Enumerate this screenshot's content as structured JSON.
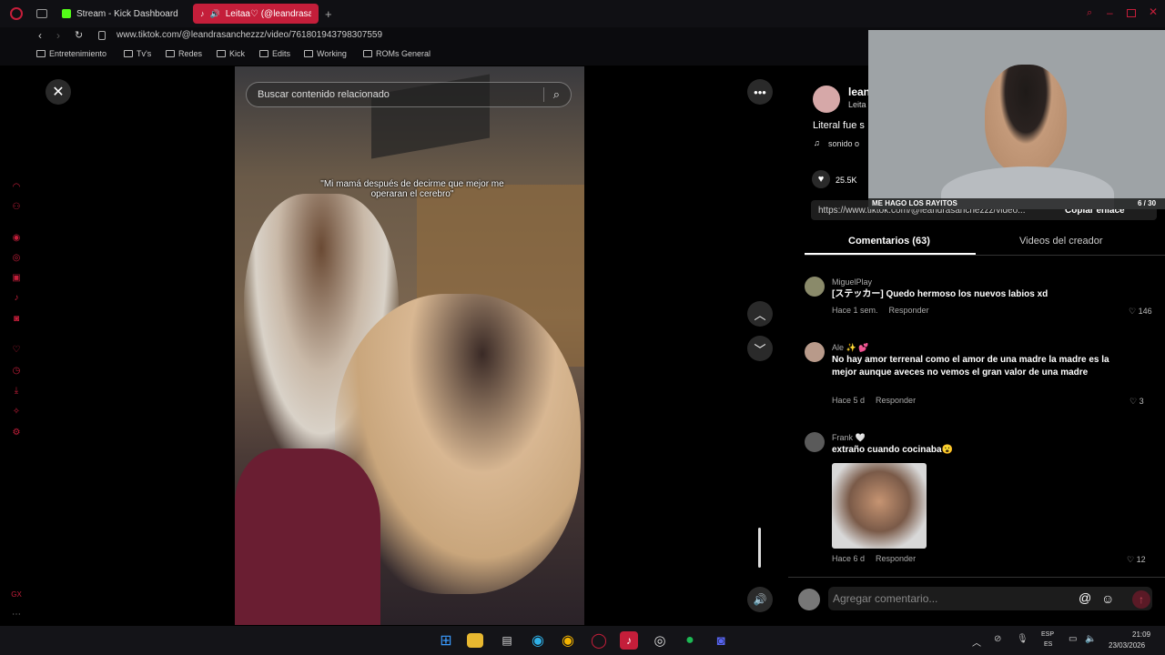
{
  "tabs": [
    {
      "label": "Stream - Kick Dashboard",
      "icon": "kick-icon"
    },
    {
      "label": "Leitaa♡ (@leandrasan",
      "icon": "tiktok-icon"
    }
  ],
  "address": {
    "url": "www.tiktok.com/@leandrasanchezzz/video/761801943798307559"
  },
  "bookmarks": [
    "Entretenimiento",
    "Tv's",
    "Redes",
    "Kick",
    "Edits",
    "Working",
    "ROMs General"
  ],
  "video": {
    "search_placeholder": "Buscar contenido relacionado",
    "caption": "\"Mi mamá después de decirme que mejor me operaran el cerebro\""
  },
  "creator": {
    "name": "lean",
    "nickname": "Leita",
    "description": "Literal fue s",
    "sound": "sonido o",
    "likes": "25.5K",
    "link": "https://www.tiktok.com/@leandrasanchezzz/video...",
    "copy_link_label": "Copiar enlace"
  },
  "panel_tabs": {
    "comments": "Comentarios (63)",
    "creator_videos": "Videos del creador"
  },
  "comments": [
    {
      "user": "MiguelPlay",
      "text": "[ステッカー] Quedo hermoso los nuevos labios xd",
      "time": "Hace 1 sem.",
      "reply": "Responder",
      "likes": "146"
    },
    {
      "user": "Ale ✨ 💕",
      "text": "No hay amor terrenal como el amor de una madre la madre es la mejor aunque aveces no vemos el gran valor de una madre",
      "time": "Hace 5 d",
      "reply": "Responder",
      "likes": "3"
    },
    {
      "user": "Frank 🤍",
      "text": "extraño cuando cocinaba😮",
      "time": "Hace 6 d",
      "reply": "Responder",
      "likes": "12"
    }
  ],
  "comment_input": {
    "placeholder": "Agregar comentario..."
  },
  "overlay": {
    "banner": "ME HAGO LOS RAYITOS",
    "counter": "6 / 30"
  },
  "system": {
    "lang_top": "ESP",
    "lang_bottom": "ES",
    "time": "21:09",
    "date": "23/03/2026"
  },
  "colors": {
    "accent": "#c41e3a",
    "like_red": "#fe2c55"
  }
}
